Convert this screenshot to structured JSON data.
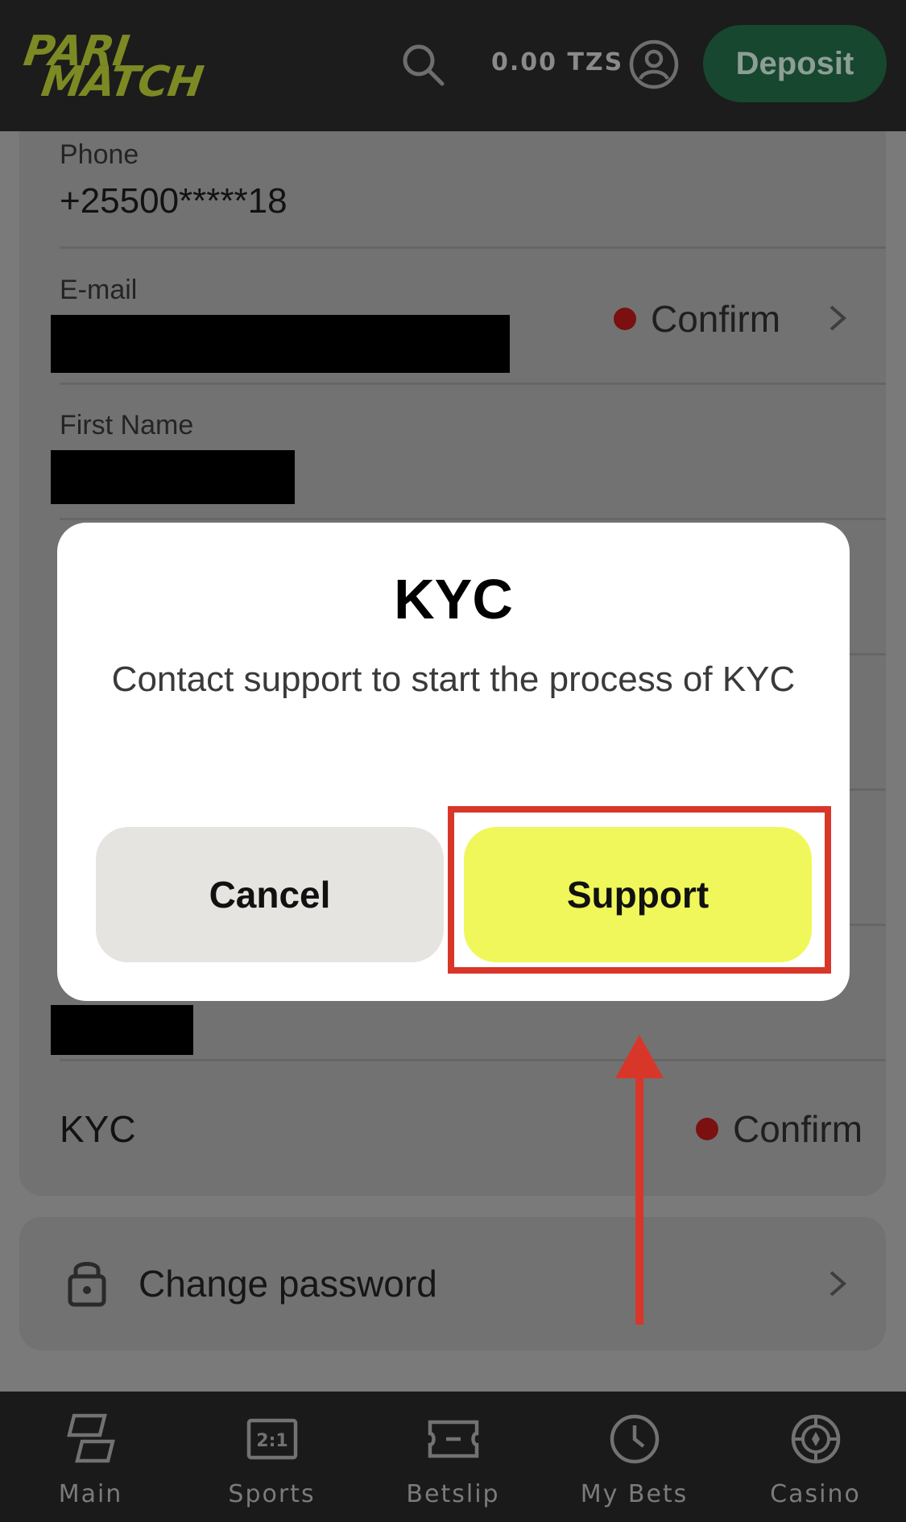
{
  "header": {
    "logo_line1": "PARI",
    "logo_line2": "MATCH",
    "balance": "0.00 TZS",
    "deposit_label": "Deposit"
  },
  "profile": {
    "phone_label": "Phone",
    "phone_value": "+25500*****18",
    "email_label": "E-mail",
    "email_status": "Confirm",
    "first_name_label": "First Name",
    "kyc_label": "KYC",
    "kyc_status": "Confirm",
    "change_password_label": "Change password"
  },
  "modal": {
    "title": "KYC",
    "message": "Contact support to start the process of KYC",
    "cancel_label": "Cancel",
    "support_label": "Support"
  },
  "tabbar": {
    "items": [
      {
        "label": "Main",
        "icon": "main-icon"
      },
      {
        "label": "Sports",
        "icon": "sports-icon"
      },
      {
        "label": "Betslip",
        "icon": "betslip-icon"
      },
      {
        "label": "My Bets",
        "icon": "clock-icon"
      },
      {
        "label": "Casino",
        "icon": "casino-chip-icon"
      }
    ]
  },
  "colors": {
    "accent_yellow": "#f0f75a",
    "deposit_green": "#17472e",
    "highlight_red": "#d9362a",
    "status_dot": "#7a1010"
  }
}
